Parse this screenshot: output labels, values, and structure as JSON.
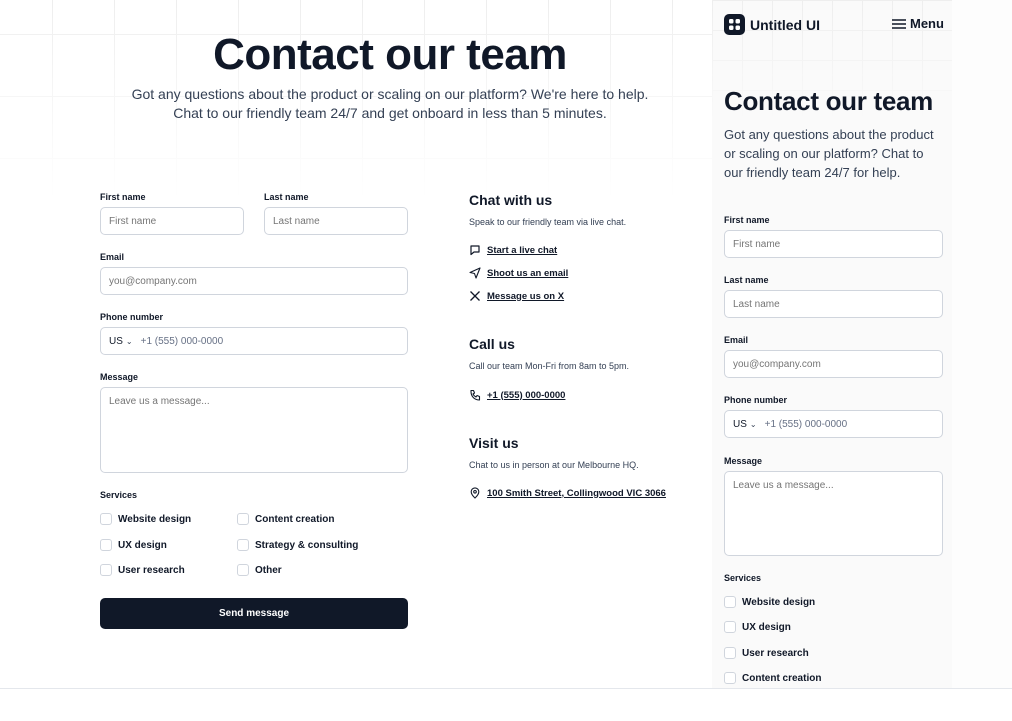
{
  "desktop": {
    "title": "Contact our team",
    "subtitle_line1": "Got any questions about the product or scaling on our platform? We're here to help.",
    "subtitle_line2": "Chat to our friendly team 24/7 and get onboard in less than 5 minutes.",
    "form": {
      "first_name_label": "First name",
      "first_name_placeholder": "First name",
      "last_name_label": "Last name",
      "last_name_placeholder": "Last name",
      "email_label": "Email",
      "email_placeholder": "you@company.com",
      "phone_label": "Phone number",
      "country_code": "US",
      "phone_placeholder": "+1 (555) 000-0000",
      "message_label": "Message",
      "message_placeholder": "Leave us a message...",
      "services_label": "Services",
      "services": [
        "Website design",
        "UX design",
        "User research",
        "Content creation",
        "Strategy & consulting",
        "Other"
      ],
      "submit_label": "Send message"
    },
    "info": {
      "chat_title": "Chat with us",
      "chat_text": "Speak to our friendly team via live chat.",
      "chat_links": [
        "Start a live chat",
        "Shoot us an email",
        "Message us on X"
      ],
      "call_title": "Call us",
      "call_text": "Call our team Mon-Fri from 8am to 5pm.",
      "call_phone": "+1 (555) 000-0000",
      "visit_title": "Visit us",
      "visit_text": "Chat to us in person at our Melbourne HQ.",
      "visit_address": "100 Smith Street, Collingwood VIC 3066"
    }
  },
  "mobile": {
    "brand": "Untitled UI",
    "menu_label": "Menu",
    "title": "Contact our team",
    "subtitle_line1": "Got any questions about the product",
    "subtitle_line2": "or scaling on our platform? Chat to",
    "subtitle_line3": "our friendly team 24/7 for help.",
    "first_name_label": "First name",
    "first_name_placeholder": "First name",
    "last_name_label": "Last name",
    "last_name_placeholder": "Last name",
    "email_label": "Email",
    "email_placeholder": "you@company.com",
    "phone_label": "Phone number",
    "country_code": "US",
    "phone_placeholder": "+1 (555) 000-0000",
    "message_label": "Message",
    "message_placeholder": "Leave us a message...",
    "services_label": "Services",
    "services": [
      "Website design",
      "UX design",
      "User research",
      "Content creation"
    ]
  },
  "colors": {
    "primary": "#101828",
    "border": "#d0d5dd",
    "placeholder": "#667085"
  }
}
